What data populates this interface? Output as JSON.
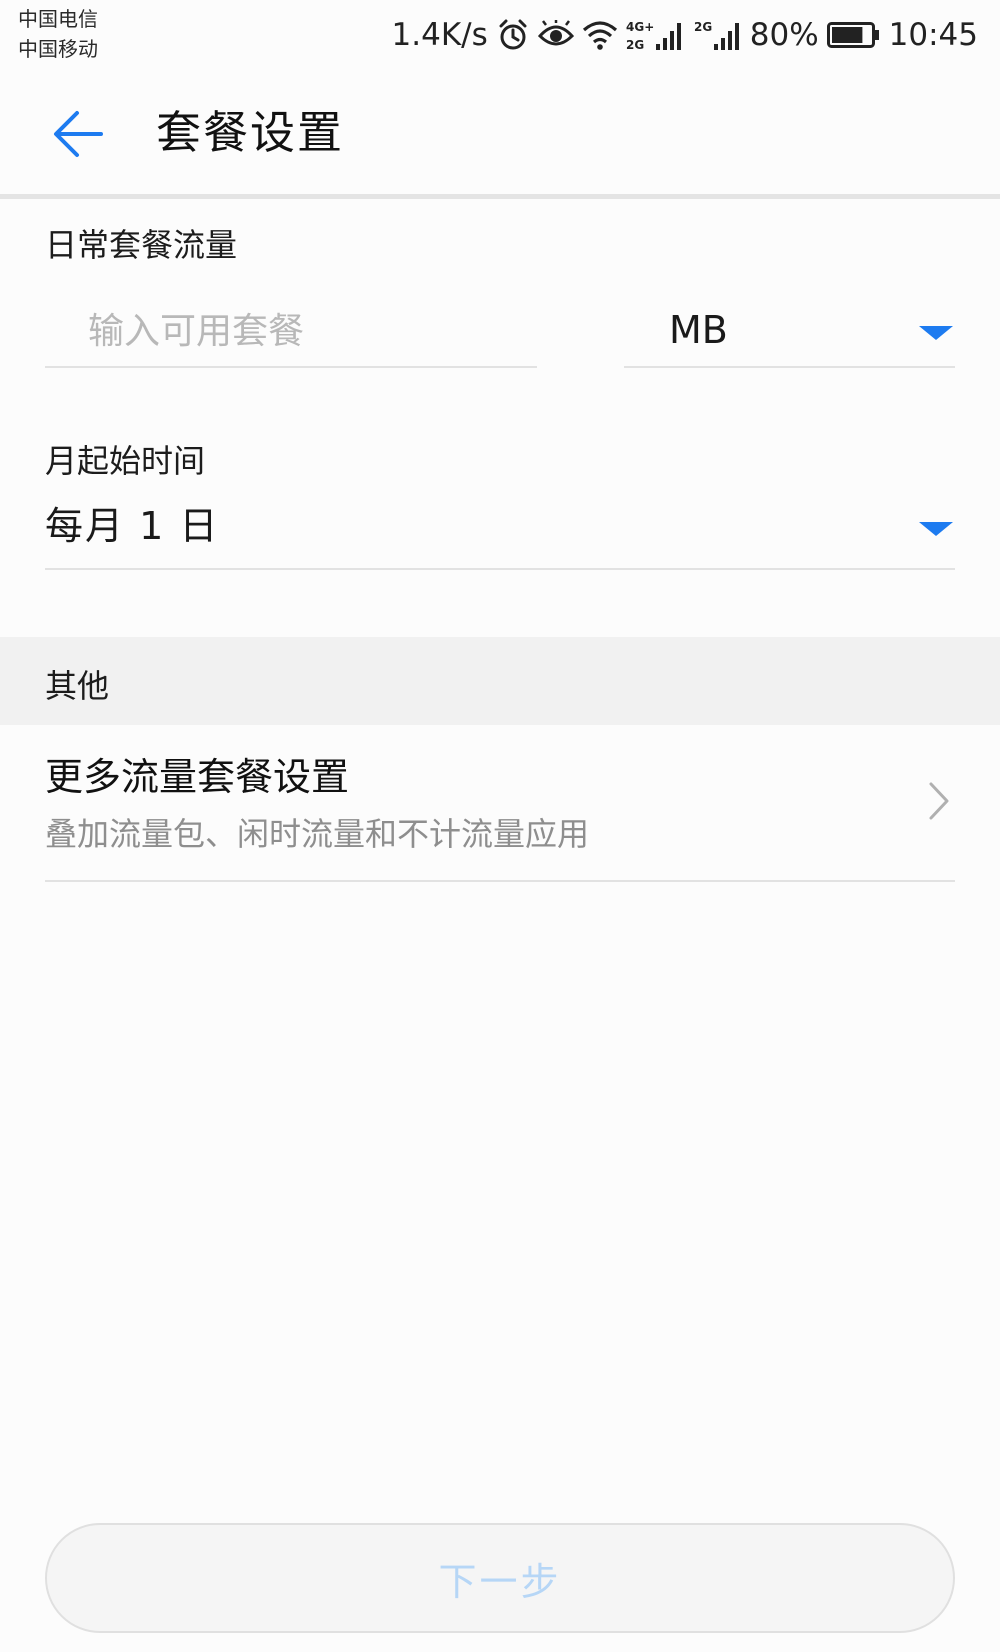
{
  "status_bar": {
    "carrier_1": "中国电信",
    "carrier_2": "中国移动",
    "net_speed": "1.4K/s",
    "signal_1_label": "4G+ 2G",
    "signal_2_label": "2G",
    "battery": "80%",
    "battery_level": 0.8,
    "time": "10:45",
    "icons": [
      "alarm-icon",
      "eye-comfort-icon",
      "wifi-icon",
      "signal-icon",
      "signal-icon",
      "battery-icon"
    ]
  },
  "header": {
    "title": "套餐设置",
    "back_icon": "arrow-left-icon"
  },
  "daily_plan": {
    "label": "日常套餐流量",
    "input_placeholder": "输入可用套餐",
    "input_value": "",
    "unit_selected": "MB"
  },
  "month_start": {
    "label": "月起始时间",
    "selected": "每月 1 日"
  },
  "other_section": {
    "title": "其他",
    "more_settings": {
      "title": "更多流量套餐设置",
      "subtitle": "叠加流量包、闲时流量和不计流量应用"
    }
  },
  "footer": {
    "next_label": "下一步"
  },
  "colors": {
    "accent": "#1d7bf0",
    "disabled_text": "#b6d6f6",
    "section_band": "#f1f1f1",
    "divider": "#e2e2e2"
  }
}
